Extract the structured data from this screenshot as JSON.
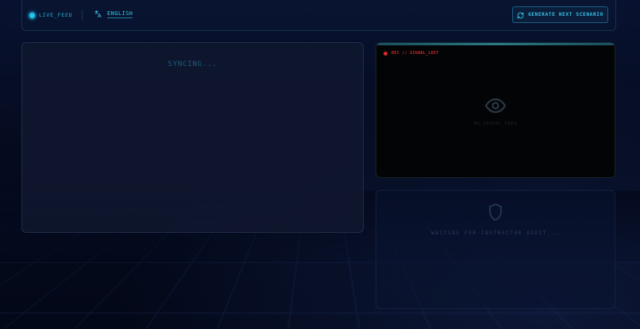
{
  "header": {
    "live_label": "LIVE_FEED",
    "language_label": "ENGLISH",
    "language_icon": "translate-icon",
    "generate_button_label": "GENERATE NEXT SCENARIO",
    "generate_button_icon": "refresh-icon"
  },
  "main_panel": {
    "status_text": "SYNCING..."
  },
  "video_feed": {
    "rec_label": "REC // SIGNAL_LOST",
    "placeholder_icon": "eye-icon",
    "placeholder_text": "NO_VISUAL_FEED"
  },
  "audit_panel": {
    "icon": "shield-icon",
    "status_text": "WAITING FOR INSTRUCTOR AUDIT..."
  },
  "colors": {
    "accent": "#22c5ee",
    "rec_red": "#e02828",
    "background": "#050b1f"
  }
}
